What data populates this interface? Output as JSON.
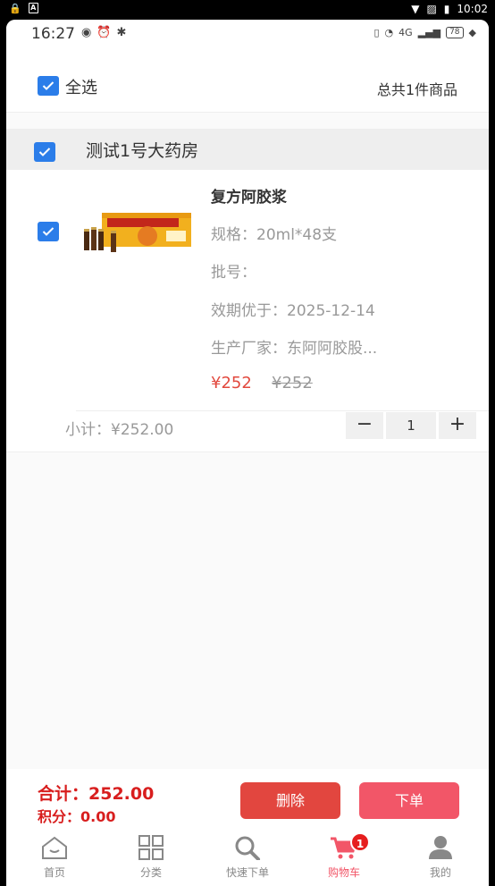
{
  "system_bar": {
    "time": "10:02"
  },
  "status": {
    "time": "16:27",
    "battery": "78",
    "network": "4G"
  },
  "header": {
    "select_all_label": "全选",
    "total_label": "总共1件商品"
  },
  "store": {
    "name": "测试1号大药房"
  },
  "item": {
    "name": "复方阿胶浆",
    "spec": "规格：20ml*48支",
    "batch": "批号：",
    "expiry": "效期优于：2025-12-14",
    "manufacturer": "生产厂家：东阿阿胶股...",
    "price": "¥252",
    "original_price": "¥252",
    "subtotal": "小计：¥252.00",
    "quantity": "1",
    "minus_label": "−",
    "plus_label": "+"
  },
  "footer": {
    "sum": "合计：252.00",
    "points": "积分：0.00",
    "delete_label": "删除",
    "order_label": "下单"
  },
  "tabs": [
    {
      "label": "首页",
      "icon": "home-icon"
    },
    {
      "label": "分类",
      "icon": "grid-icon"
    },
    {
      "label": "快速下单",
      "icon": "search-icon"
    },
    {
      "label": "购物车",
      "icon": "cart-icon",
      "badge": "1",
      "active": true
    },
    {
      "label": "我的",
      "icon": "user-icon"
    }
  ],
  "colors": {
    "accent_blue": "#2b7de9",
    "price_red": "#e2493e",
    "active_pink": "#f25668"
  }
}
